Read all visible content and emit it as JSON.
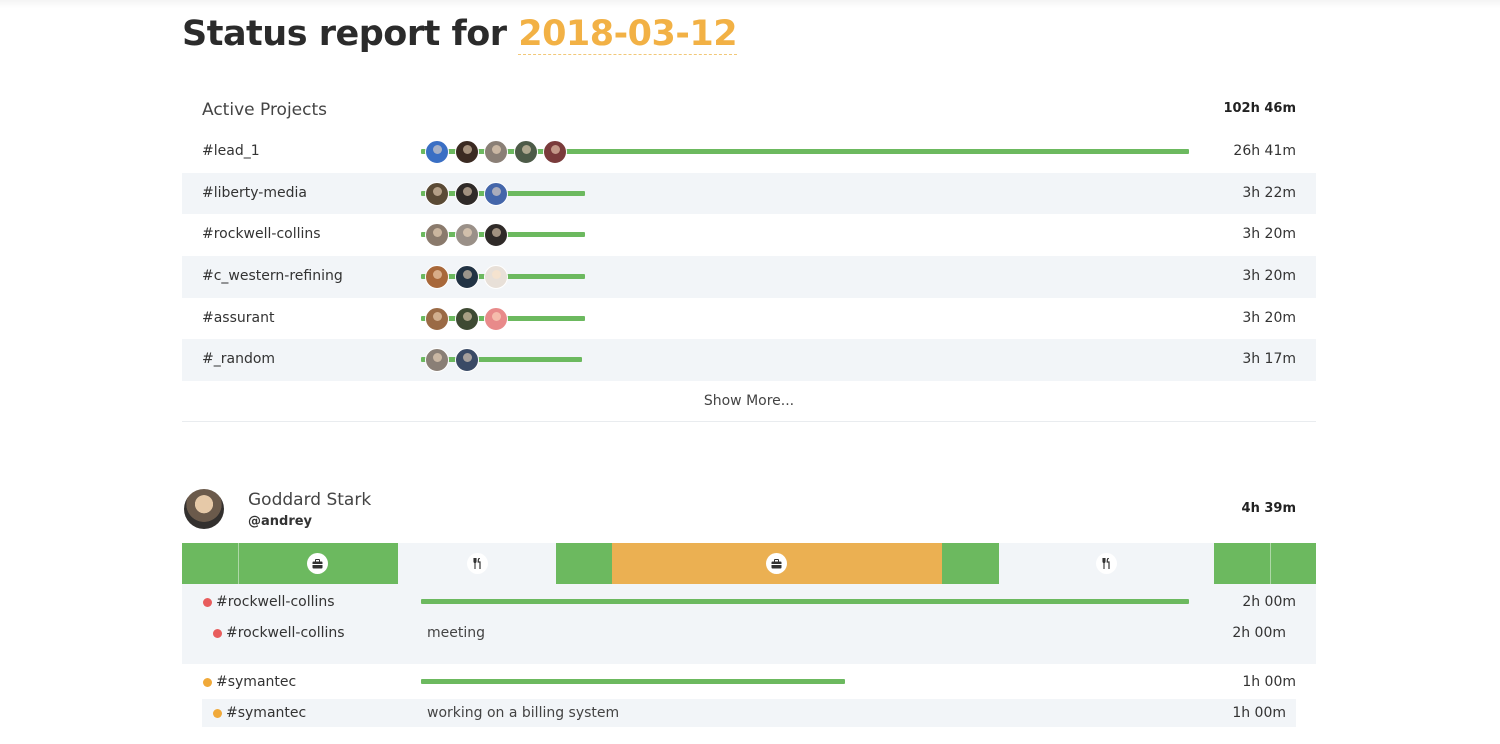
{
  "header": {
    "title_prefix": "Status report for",
    "date": "2018-03-12"
  },
  "projects": {
    "title": "Active Projects",
    "total": "102h 46m",
    "rows": [
      {
        "name": "#lead_1",
        "time": "26h 41m",
        "fraction": 0.985,
        "avatars": [
          "#3a6fc4",
          "#3b2a22",
          "#8a7f76",
          "#4d5b48",
          "#7a3b3b"
        ]
      },
      {
        "name": "#liberty-media",
        "time": "3h 22m",
        "fraction": 0.21,
        "avatars": [
          "#5a4a35",
          "#2f2a28",
          "#4466aa"
        ]
      },
      {
        "name": "#rockwell-collins",
        "time": "3h 20m",
        "fraction": 0.21,
        "avatars": [
          "#8a7a6c",
          "#9a9088",
          "#2f2a28"
        ]
      },
      {
        "name": "#c_western-refining",
        "time": "3h 20m",
        "fraction": 0.21,
        "avatars": [
          "#a8683a",
          "#223344",
          "#e8e0d8"
        ]
      },
      {
        "name": "#assurant",
        "time": "3h 20m",
        "fraction": 0.21,
        "avatars": [
          "#9a6a45",
          "#3e4a33",
          "#e88a8a"
        ]
      },
      {
        "name": "#_random",
        "time": "3h 17m",
        "fraction": 0.207,
        "avatars": [
          "#8a7f76",
          "#3a4a66"
        ]
      }
    ],
    "show_more": "Show More..."
  },
  "user": {
    "name": "Goddard Stark",
    "handle": "@andrey",
    "total": "4h 39m",
    "timeline_icons": {
      "work": "briefcase-icon",
      "lunch": "fork-knife-icon"
    },
    "entries": [
      {
        "project": "#rockwell-collins",
        "time": "2h 00m",
        "fraction": 0.985,
        "dot": "#e85d5d",
        "sub": {
          "project": "#rockwell-collins",
          "desc": "meeting",
          "time": "2h 00m"
        }
      },
      {
        "project": "#symantec",
        "time": "1h 00m",
        "fraction": 0.543,
        "dot": "#f0a93a",
        "sub": {
          "project": "#symantec",
          "desc": "working on a billing system",
          "time": "1h 00m"
        }
      }
    ]
  },
  "colors": {
    "accent": "#f2b145",
    "bar": "#6cb95f",
    "orange": "#ebb052"
  }
}
